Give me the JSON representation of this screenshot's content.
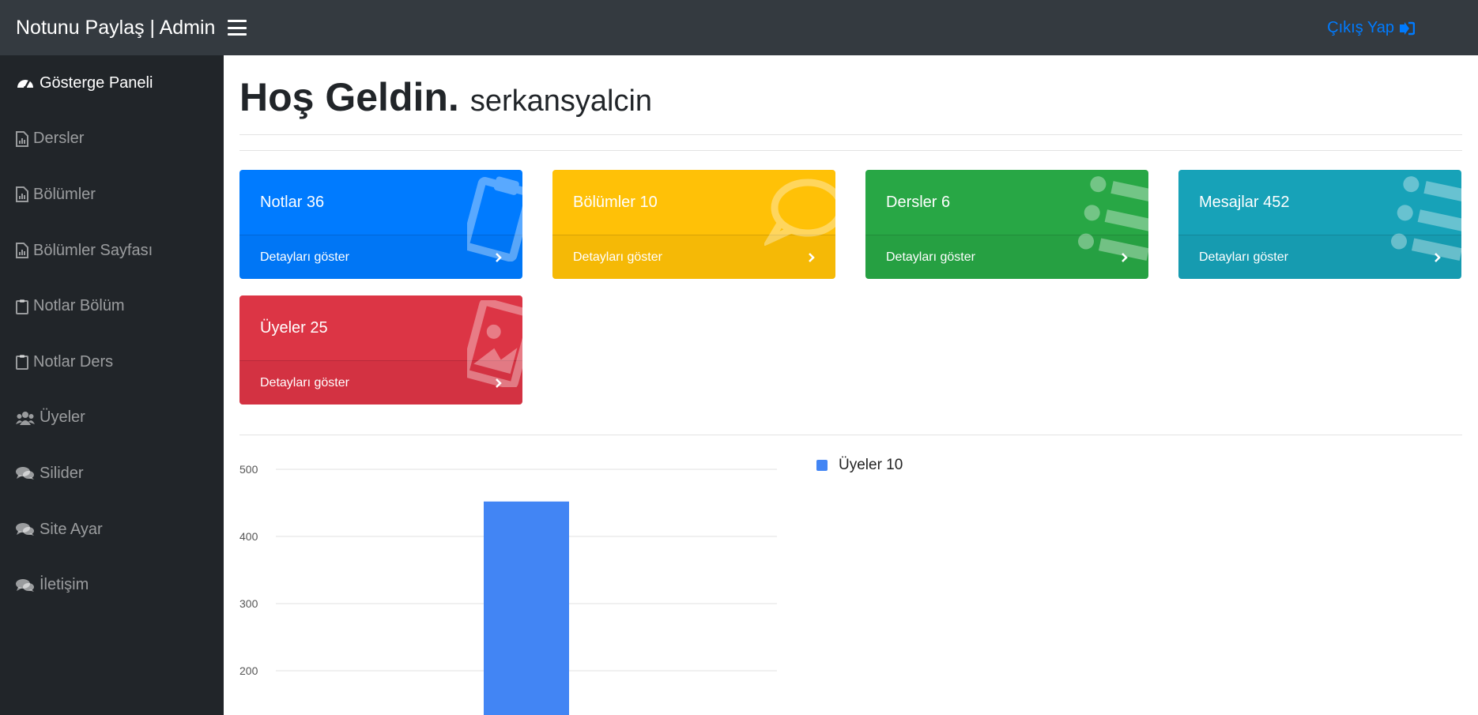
{
  "topbar": {
    "brand": "Notunu Paylaş | Admin",
    "logout_label": "Çıkış Yap"
  },
  "sidebar": {
    "items": [
      {
        "label": "Gösterge Paneli",
        "icon": "tachometer-icon",
        "active": true
      },
      {
        "label": "Dersler",
        "icon": "file-chart-icon"
      },
      {
        "label": "Bölümler",
        "icon": "file-chart-icon"
      },
      {
        "label": "Bölümler Sayfası",
        "icon": "file-chart-icon"
      },
      {
        "label": "Notlar Bölüm",
        "icon": "clipboard-icon"
      },
      {
        "label": "Notlar Ders",
        "icon": "clipboard-icon"
      },
      {
        "label": "Üyeler",
        "icon": "users-icon"
      },
      {
        "label": "Silider",
        "icon": "comments-icon"
      },
      {
        "label": "Site Ayar",
        "icon": "comments-icon"
      },
      {
        "label": "İletişim",
        "icon": "comments-icon"
      }
    ]
  },
  "header": {
    "greeting": "Hoş Geldin.",
    "username": "serkansyalcin"
  },
  "cards": [
    {
      "title": "Notlar 36",
      "footer": "Detayları göster",
      "color": "#007bff",
      "icon": "clipboard-icon"
    },
    {
      "title": "Bölümler 10",
      "footer": "Detayları göster",
      "color": "#ffc107",
      "icon": "comment-icon"
    },
    {
      "title": "Dersler 6",
      "footer": "Detayları göster",
      "color": "#28a745",
      "icon": "list-icon"
    },
    {
      "title": "Mesajlar 452",
      "footer": "Detayları göster",
      "color": "#17a2b8",
      "icon": "list-icon"
    },
    {
      "title": "Üyeler 25",
      "footer": "Detayları göster",
      "color": "#dc3545",
      "icon": "image-icon"
    }
  ],
  "chart_data": {
    "type": "bar",
    "categories": [
      ""
    ],
    "series": [
      {
        "name": "Üyeler 10",
        "values": [
          452
        ],
        "color": "#4285f4"
      }
    ],
    "ylim": [
      0,
      500
    ],
    "yticks": [
      500,
      400,
      300,
      200
    ],
    "grid": true,
    "legend": "right"
  }
}
